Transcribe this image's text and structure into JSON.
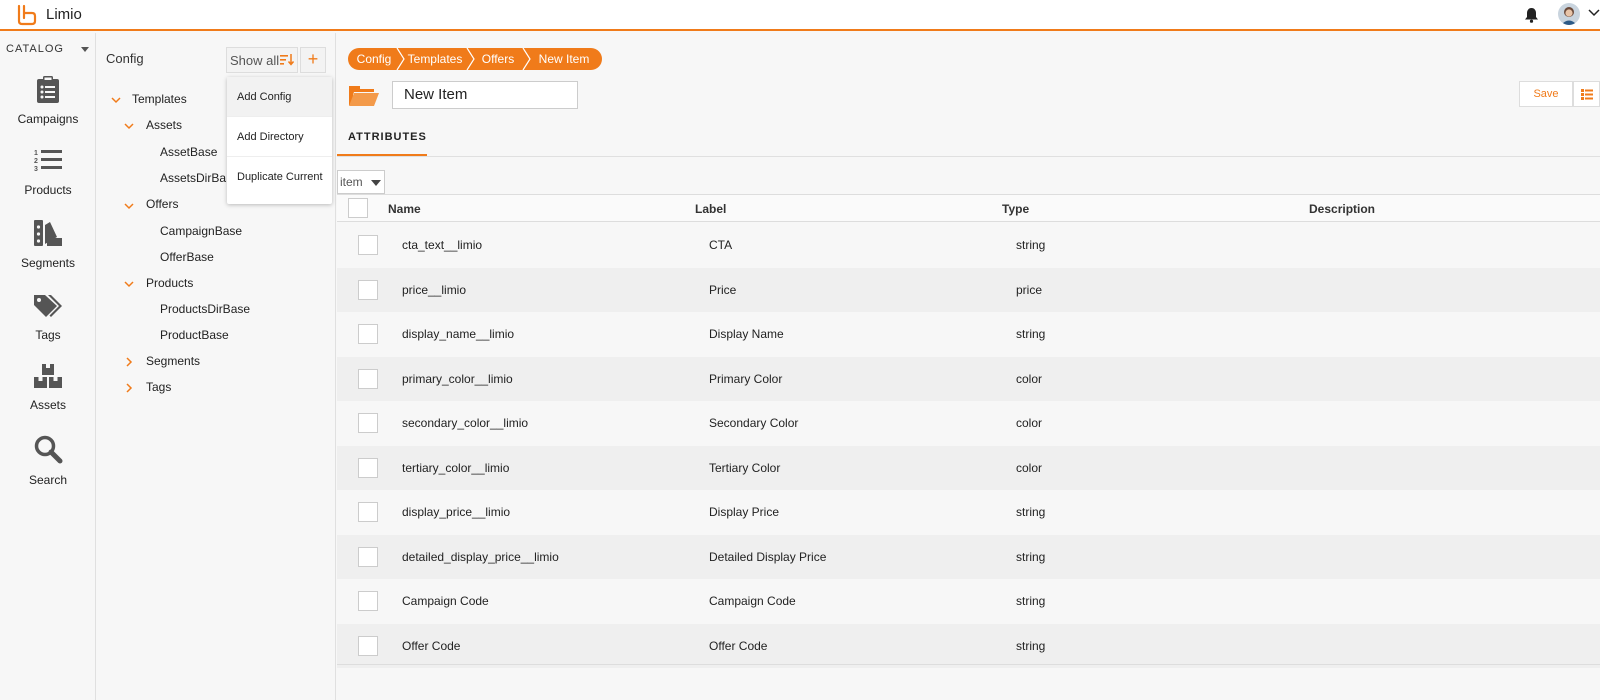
{
  "app": {
    "brand": "Limio"
  },
  "colors": {
    "accent": "#f07b1a"
  },
  "topbar": {
    "icons": [
      "logo-icon",
      "bell-icon",
      "avatar",
      "chevron-down-icon"
    ]
  },
  "rail": {
    "section": "CATALOG",
    "items": [
      {
        "label": "Campaigns",
        "icon": "clipboard-icon"
      },
      {
        "label": "Products",
        "icon": "numbered-list-icon"
      },
      {
        "label": "Segments",
        "icon": "segments-icon"
      },
      {
        "label": "Tags",
        "icon": "tags-icon"
      },
      {
        "label": "Assets",
        "icon": "boxes-icon"
      },
      {
        "label": "Search",
        "icon": "search-icon"
      }
    ]
  },
  "tree": {
    "title": "Config",
    "show_all": "Show all",
    "add": "+",
    "nodes": [
      {
        "label": "Templates",
        "expanded": true
      },
      {
        "label": "Assets",
        "expanded": true
      },
      {
        "label": "AssetBase"
      },
      {
        "label": "AssetsDirBase"
      },
      {
        "label": "Offers",
        "expanded": true
      },
      {
        "label": "CampaignBase"
      },
      {
        "label": "OfferBase"
      },
      {
        "label": "Products",
        "expanded": true
      },
      {
        "label": "ProductsDirBase"
      },
      {
        "label": "ProductBase"
      },
      {
        "label": "Segments",
        "expanded": false
      },
      {
        "label": "Tags",
        "expanded": false
      }
    ],
    "dropdown": [
      "Add Config",
      "Add Directory",
      "Duplicate Current"
    ]
  },
  "main": {
    "breadcrumbs": [
      "Config",
      "Templates",
      "Offers",
      "New Item"
    ],
    "item_name": "New Item",
    "save_label": "Save",
    "tab_label": "ATTRIBUTES",
    "item_select": "item",
    "columns": [
      "Name",
      "Label",
      "Type",
      "Description"
    ],
    "rows": [
      {
        "name": "cta_text__limio",
        "label": "CTA",
        "type": "string",
        "description": ""
      },
      {
        "name": "price__limio",
        "label": "Price",
        "type": "price",
        "description": ""
      },
      {
        "name": "display_name__limio",
        "label": "Display Name",
        "type": "string",
        "description": ""
      },
      {
        "name": "primary_color__limio",
        "label": "Primary Color",
        "type": "color",
        "description": ""
      },
      {
        "name": "secondary_color__limio",
        "label": "Secondary Color",
        "type": "color",
        "description": ""
      },
      {
        "name": "tertiary_color__limio",
        "label": "Tertiary Color",
        "type": "color",
        "description": ""
      },
      {
        "name": "display_price__limio",
        "label": "Display Price",
        "type": "string",
        "description": ""
      },
      {
        "name": "detailed_display_price__limio",
        "label": "Detailed Display Price",
        "type": "string",
        "description": ""
      },
      {
        "name": "Campaign Code",
        "label": "Campaign Code",
        "type": "string",
        "description": ""
      },
      {
        "name": "Offer Code",
        "label": "Offer Code",
        "type": "string",
        "description": ""
      }
    ]
  }
}
